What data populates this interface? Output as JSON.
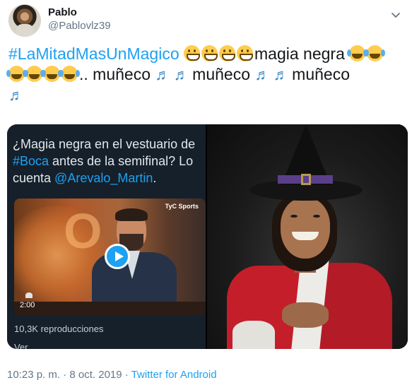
{
  "author": {
    "name": "Pablo",
    "handle": "@Pablovlz39"
  },
  "tweet": {
    "hashtag": "#LaMitadMasUnMagico",
    "text_1": "magia negra",
    "text_2": ".. muñeco",
    "text_3": "muñeco",
    "text_4": "muñeco",
    "emoji": {
      "grin": "grinning-face",
      "joy": "face-with-tears-of-joy",
      "music": "musical-notes"
    }
  },
  "quoted": {
    "line1": "¿Magia negra en el vestuario de",
    "hashtag": "#Boca",
    "line2_rest": " antes de la semifinal? Lo",
    "line3_prefix": "cuenta ",
    "mention": "@Arevalo_Martin",
    "line3_suffix": ".",
    "duration": "2:00",
    "views": "10,3K reproducciones",
    "more": "Ver",
    "channel_logo": "TyC Sports"
  },
  "footer": {
    "time": "10:23 p. m. · 8 oct. 2019 · ",
    "source": "Twitter for Android"
  },
  "colors": {
    "link": "#1da1f2",
    "text": "#14171a",
    "muted": "#657786"
  }
}
